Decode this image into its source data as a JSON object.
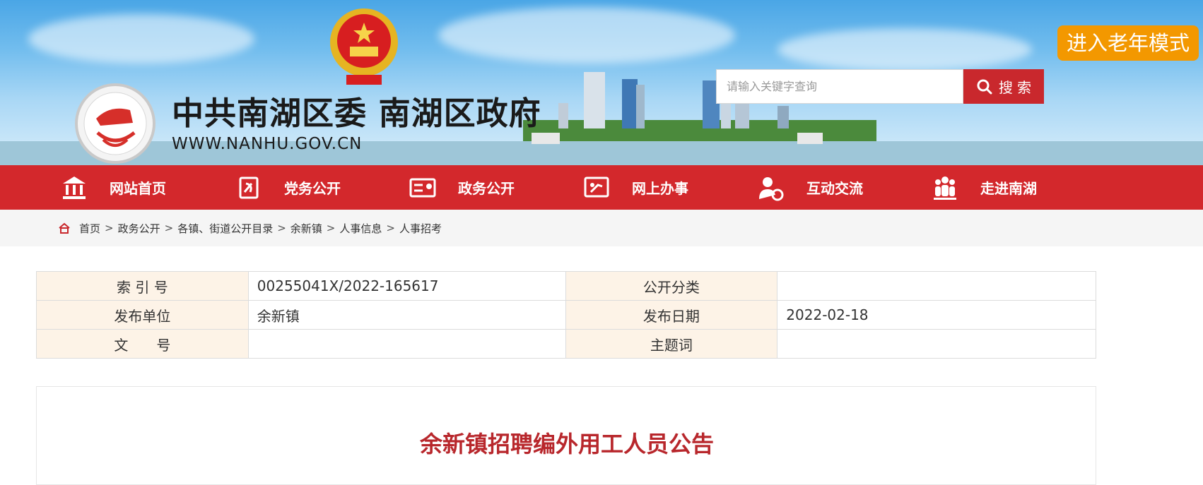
{
  "header": {
    "site_title": "中共南湖区委 南湖区政府",
    "site_url": "WWW.NANHU.GOV.CN",
    "elder_mode_label": "进入老年模式",
    "search": {
      "placeholder": "请输入关键字查询",
      "button_label": "搜 索",
      "icon": "search-icon"
    }
  },
  "nav": {
    "items": [
      {
        "label": "网站首页",
        "icon": "government-building-icon"
      },
      {
        "label": "党务公开",
        "icon": "party-flag-icon"
      },
      {
        "label": "政务公开",
        "icon": "id-card-icon"
      },
      {
        "label": "网上办事",
        "icon": "online-service-icon"
      },
      {
        "label": "互动交流",
        "icon": "user-chat-icon"
      },
      {
        "label": "走进南湖",
        "icon": "people-group-icon"
      }
    ]
  },
  "breadcrumb": {
    "icon": "home-icon",
    "items": [
      "首页",
      "政务公开",
      "各镇、街道公开目录",
      "余新镇",
      "人事信息",
      "人事招考"
    ],
    "separator": ">"
  },
  "meta": {
    "rows": [
      {
        "k1": "索 引 号",
        "v1": "00255041X/2022-165617",
        "k2": "公开分类",
        "v2": ""
      },
      {
        "k1": "发布单位",
        "v1": "余新镇",
        "k2": "发布日期",
        "v2": "2022-02-18"
      },
      {
        "k1": "文　　号",
        "v1": "",
        "k2": "主题词",
        "v2": ""
      }
    ]
  },
  "article": {
    "title": "余新镇招聘编外用工人员公告"
  },
  "colors": {
    "nav_red": "#d3282c",
    "elder_orange": "#f39800",
    "title_red": "#b8272c",
    "label_bg": "#fdf3e7"
  }
}
